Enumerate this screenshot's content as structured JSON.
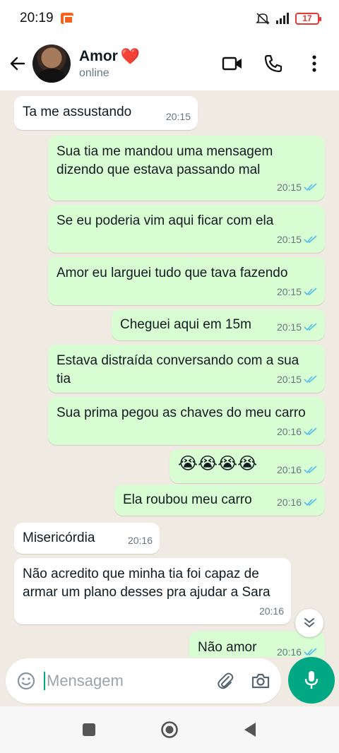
{
  "status_bar": {
    "time": "20:19",
    "battery": "17"
  },
  "header": {
    "name": "Amor",
    "name_emoji": "❤️",
    "status": "online"
  },
  "messages": [
    {
      "dir": "in",
      "text": "Ta me assustando",
      "time": "20:15"
    },
    {
      "dir": "out",
      "text": "Sua tia me mandou uma mensagem dizendo que estava passando mal",
      "time": "20:15",
      "read": true
    },
    {
      "dir": "out",
      "text": "Se eu poderia vim aqui ficar com ela",
      "time": "20:15",
      "read": true
    },
    {
      "dir": "out",
      "text": "Amor eu larguei tudo que tava fazendo",
      "time": "20:15",
      "read": true
    },
    {
      "dir": "out",
      "text": "Cheguei aqui em 15m",
      "time": "20:15",
      "read": true
    },
    {
      "dir": "out",
      "text": "Estava distraída conversando com a sua tia",
      "time": "20:15",
      "read": true
    },
    {
      "dir": "out",
      "text": "Sua prima pegou as chaves do meu carro",
      "time": "20:16",
      "read": true
    },
    {
      "dir": "out",
      "text": "😭😭😭😭",
      "time": "20:16",
      "read": true
    },
    {
      "dir": "out",
      "text": "Ela roubou meu carro",
      "time": "20:16",
      "read": true
    },
    {
      "dir": "in",
      "text": "Misericórdia",
      "time": "20:16"
    },
    {
      "dir": "in",
      "text": "Não acredito que minha tia foi capaz de armar um plano desses pra ajudar a Sara",
      "time": "20:16"
    },
    {
      "dir": "out",
      "text": "Não amor",
      "time": "20:16",
      "read": true
    }
  ],
  "composer": {
    "placeholder": "Mensagem"
  },
  "colors": {
    "accent": "#00a884",
    "outgoing_bubble": "#d9fdd3",
    "incoming_bubble": "#ffffff",
    "read_tick": "#53bdeb"
  },
  "icons": [
    "back-arrow-icon",
    "video-call-icon",
    "phone-icon",
    "more-options-icon",
    "emoji-icon",
    "attach-icon",
    "camera-icon",
    "mic-icon",
    "scroll-down-icon",
    "recents-icon",
    "home-icon",
    "back-icon"
  ]
}
